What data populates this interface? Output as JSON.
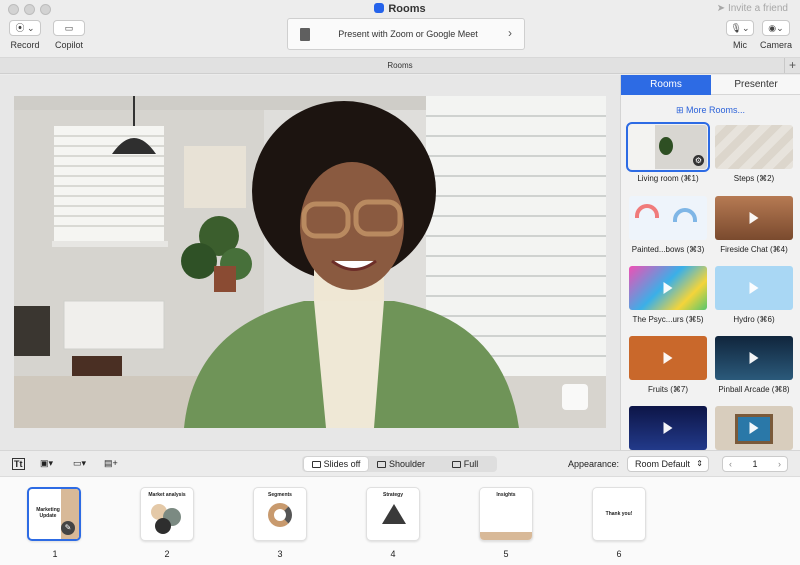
{
  "window": {
    "title": "Rooms",
    "invite": "Invite a friend"
  },
  "header": {
    "record_label": "Record",
    "copilot_label": "Copilot",
    "present_text": "Present with Zoom or Google Meet",
    "mic_label": "Mic",
    "camera_label": "Camera"
  },
  "bar": {
    "title": "Rooms"
  },
  "sidebar": {
    "tab_rooms": "Rooms",
    "tab_presenter": "Presenter",
    "more_rooms": "More Rooms...",
    "rooms": [
      {
        "label": "Living room (⌘1)",
        "selected": true
      },
      {
        "label": "Steps (⌘2)"
      },
      {
        "label": "Painted...bows (⌘3)"
      },
      {
        "label": "Fireside Chat (⌘4)"
      },
      {
        "label": "The Psyc...urs (⌘5)"
      },
      {
        "label": "Hydro (⌘6)"
      },
      {
        "label": "Fruits (⌘7)"
      },
      {
        "label": "Pinball Arcade (⌘8)"
      },
      {
        "label": ""
      },
      {
        "label": ""
      }
    ]
  },
  "toolbar": {
    "mode_slides_off": "Slides off",
    "mode_shoulder": "Shoulder",
    "mode_full": "Full",
    "appearance_label": "Appearance:",
    "appearance_value": "Room Default",
    "page_value": "1"
  },
  "slides": [
    {
      "number": "1",
      "title": "Marketing Update",
      "selected": true
    },
    {
      "number": "2",
      "title": "Market analysis"
    },
    {
      "number": "3",
      "title": "Segments"
    },
    {
      "number": "4",
      "title": "Strategy"
    },
    {
      "number": "5",
      "title": "Insights"
    },
    {
      "number": "6",
      "title": "Thank you!"
    }
  ]
}
